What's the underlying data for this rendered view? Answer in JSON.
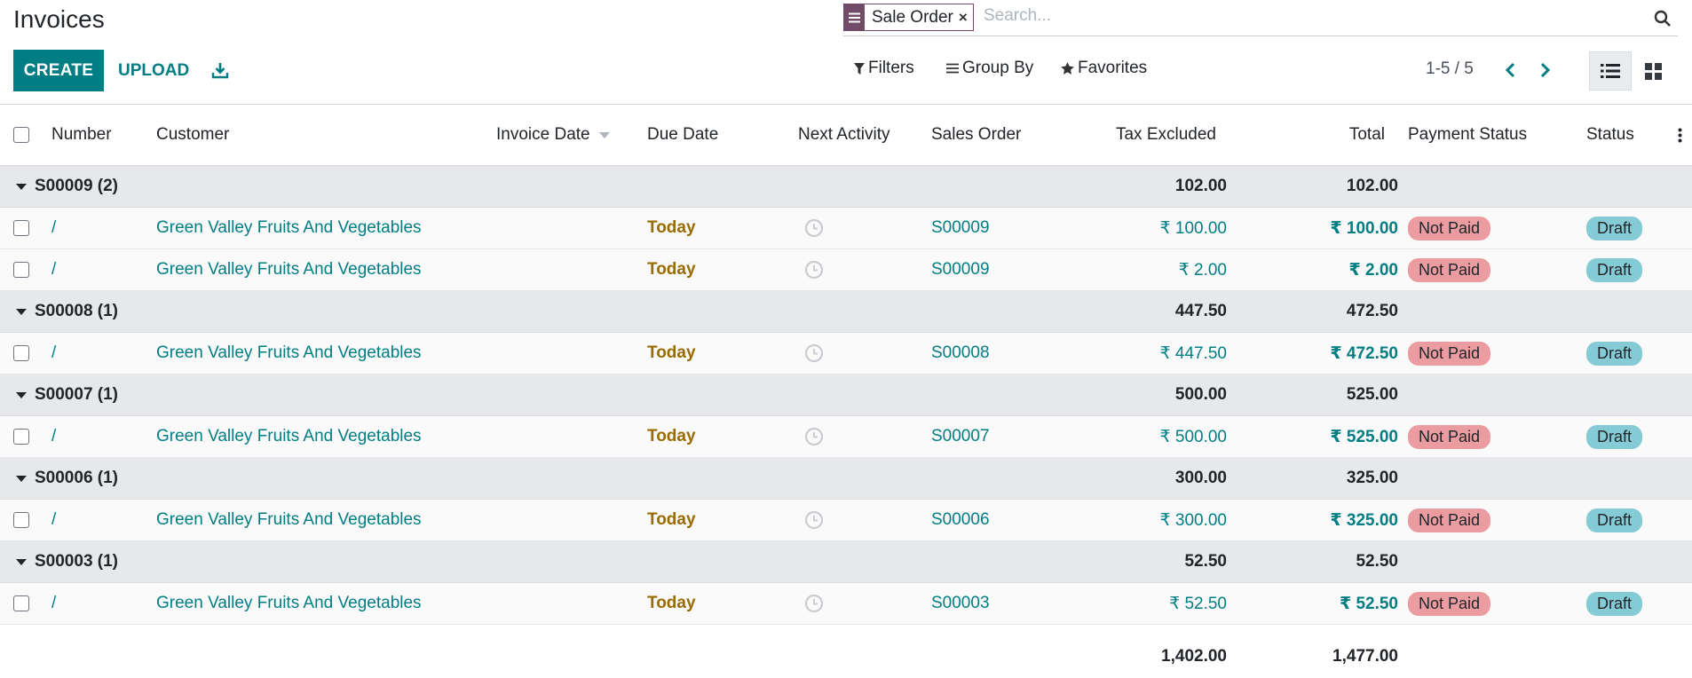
{
  "page": {
    "title": "Invoices"
  },
  "toolbar": {
    "create_label": "CREATE",
    "upload_label": "UPLOAD",
    "download_icon": "download-icon"
  },
  "search": {
    "facet_label": "Sale Order",
    "facet_icon": "group-by-icon",
    "facet_remove": "×",
    "placeholder": "Search...",
    "filters_label": "Filters",
    "groupby_label": "Group By",
    "favorites_label": "Favorites"
  },
  "pager": {
    "value": "1-5 / 5"
  },
  "columns": {
    "number": "Number",
    "customer": "Customer",
    "invoice_date": "Invoice Date",
    "due_date": "Due Date",
    "next_activity": "Next Activity",
    "sales_order": "Sales Order",
    "tax_excluded": "Tax Excluded",
    "total": "Total",
    "payment_status": "Payment Status",
    "status": "Status"
  },
  "groups": [
    {
      "label": "S00009 (2)",
      "tax_excluded": "102.00",
      "total": "102.00",
      "rows": [
        {
          "number": "/",
          "customer": "Green Valley Fruits And Vegetables",
          "due": "Today",
          "so": "S00009",
          "tax": "₹ 100.00",
          "total": "₹ 100.00",
          "payment": "Not Paid",
          "status": "Draft"
        },
        {
          "number": "/",
          "customer": "Green Valley Fruits And Vegetables",
          "due": "Today",
          "so": "S00009",
          "tax": "₹ 2.00",
          "total": "₹ 2.00",
          "payment": "Not Paid",
          "status": "Draft"
        }
      ]
    },
    {
      "label": "S00008 (1)",
      "tax_excluded": "447.50",
      "total": "472.50",
      "rows": [
        {
          "number": "/",
          "customer": "Green Valley Fruits And Vegetables",
          "due": "Today",
          "so": "S00008",
          "tax": "₹ 447.50",
          "total": "₹ 472.50",
          "payment": "Not Paid",
          "status": "Draft"
        }
      ]
    },
    {
      "label": "S00007 (1)",
      "tax_excluded": "500.00",
      "total": "525.00",
      "rows": [
        {
          "number": "/",
          "customer": "Green Valley Fruits And Vegetables",
          "due": "Today",
          "so": "S00007",
          "tax": "₹ 500.00",
          "total": "₹ 525.00",
          "payment": "Not Paid",
          "status": "Draft"
        }
      ]
    },
    {
      "label": "S00006 (1)",
      "tax_excluded": "300.00",
      "total": "325.00",
      "rows": [
        {
          "number": "/",
          "customer": "Green Valley Fruits And Vegetables",
          "due": "Today",
          "so": "S00006",
          "tax": "₹ 300.00",
          "total": "₹ 325.00",
          "payment": "Not Paid",
          "status": "Draft"
        }
      ]
    },
    {
      "label": "S00003 (1)",
      "tax_excluded": "52.50",
      "total": "52.50",
      "rows": [
        {
          "number": "/",
          "customer": "Green Valley Fruits And Vegetables",
          "due": "Today",
          "so": "S00003",
          "tax": "₹ 52.50",
          "total": "₹ 52.50",
          "payment": "Not Paid",
          "status": "Draft"
        }
      ]
    }
  ],
  "totals": {
    "tax_excluded": "1,402.00",
    "total": "1,477.00"
  },
  "colors": {
    "primary": "#017e84",
    "facet": "#714b67",
    "today": "#9a6b00",
    "not_paid": "#eb9ca1",
    "draft": "#85cbd6",
    "group_bg": "#e7e8eb"
  }
}
